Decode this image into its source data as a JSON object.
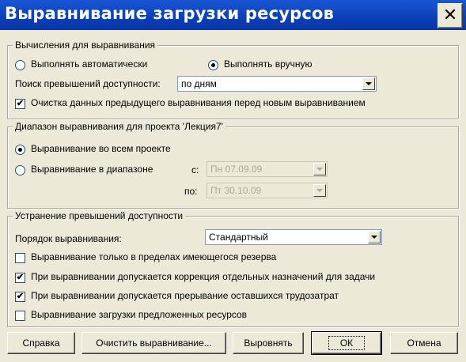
{
  "window": {
    "title": "Выравнивание загрузки ресурсов",
    "close_glyph": "✕"
  },
  "calc_group": {
    "legend": "Вычисления для выравнивания",
    "radio_auto": "Выполнять автоматически",
    "radio_manual": "Выполнять вручную",
    "selected": "manual",
    "search_label": "Поиск превышений доступности:",
    "search_value": "по дням",
    "clear_check_label": "Очистка данных предыдущего выравнивания перед новым выравниванием",
    "clear_checked": true
  },
  "range_group": {
    "legend": "Диапазон выравнивания для проекта 'Лекция7'",
    "radio_whole": "Выравнивание во всем проекте",
    "radio_range": "Выравнивание в диапазоне",
    "selected": "whole",
    "from_label": "с:",
    "from_value": "Пн 07.09.09",
    "to_label": "по:",
    "to_value": "Пт 30.10.09"
  },
  "resolve_group": {
    "legend": "Устранение превышений доступности",
    "order_label": "Порядок выравнивания:",
    "order_value": "Стандартный",
    "options": [
      {
        "label": "Выравнивание только в пределах имеющегося резерва",
        "checked": false
      },
      {
        "label": "При выравнивании допускается коррекция отдельных назначений для задачи",
        "checked": true
      },
      {
        "label": "При выравнивании допускается прерывание оставшихся трудозатрат",
        "checked": true
      },
      {
        "label": "Выравнивание загрузки предложенных ресурсов",
        "checked": false
      }
    ]
  },
  "buttons": {
    "help": "Справка",
    "clear": "Очистить выравнивание...",
    "level": "Выровнять",
    "ok": "ОК",
    "cancel": "Отмена"
  },
  "check_glyph": "✔"
}
